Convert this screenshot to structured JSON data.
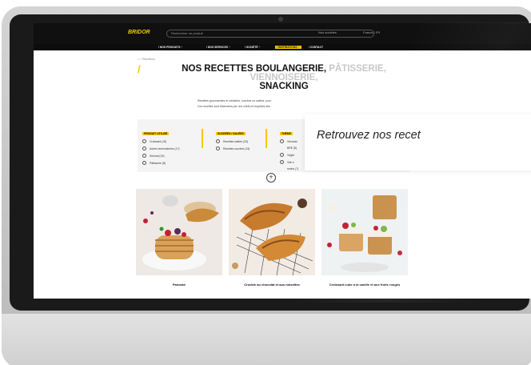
{
  "site": {
    "logo_text": "BRIDOR",
    "search_placeholder": "Rechercher un produit",
    "util_links": [
      "Nos sociétés",
      "France / FR"
    ]
  },
  "nav": {
    "items": [
      {
        "label": "/ NOS PRODUITS ~"
      },
      {
        "label": "/ NOS SERVICES ~"
      },
      {
        "label": "/ SOCIÉTÉ ~"
      },
      {
        "label": "/ INSPIRATIONS ~"
      },
      {
        "label": "/ CONTACT"
      }
    ],
    "active_index": 3
  },
  "breadcrumb": "⌂ › Recettes",
  "heading": {
    "part1": "NOS RECETTES BOULANGERIE, ",
    "part2": "PÂTISSERIE, VIENNOISERIE,",
    "part3": "SNACKING"
  },
  "intro": {
    "line1": "Recettes gourmandes et créatives, sucrées ou salées, pour",
    "line2": "Ces recettes sont élaborées par nos chefs et inspirées des"
  },
  "banner": {
    "text": "Retrouvez nos recet"
  },
  "filters": [
    {
      "title": "PRODUIT UTILISÉ",
      "options": [
        "Croissant (15)",
        "Autres viennoiseries (17)",
        "Surimal (15)",
        "Pâtisserie (8)"
      ]
    },
    {
      "title": "SUCRÉES / SALÉES",
      "options": [
        "Recettes salées (23)",
        "Recettes sucrées (13)"
      ]
    },
    {
      "title": "THÈME",
      "options": [
        "Viennois",
        "BRE (8)",
        "Végét",
        "Vite e",
        "moins (7)"
      ]
    }
  ],
  "plus_button": "+",
  "cards": [
    {
      "title": "Pancake"
    },
    {
      "title": "Crookie au chocolat et aux noisettes"
    },
    {
      "title": "Croissant cube à la vanille et aux fruits rouges"
    }
  ],
  "colors": {
    "accent": "#f5c800",
    "dark": "#101010",
    "panel": "#f4f4f4"
  }
}
